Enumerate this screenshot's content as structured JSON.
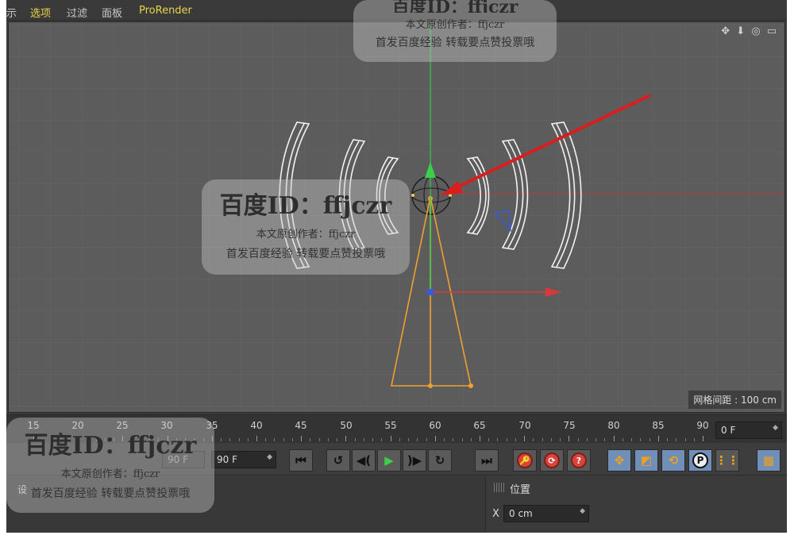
{
  "menu": {
    "items": [
      "示",
      "选项",
      "过滤",
      "面板",
      "ProRender"
    ],
    "active_color": "#e8d44a"
  },
  "viewport": {
    "grid_label": "网格间距 : 100 cm",
    "axis_colors": {
      "x": "#d83a3a",
      "y": "#3ad04a",
      "z": "#3a5ad8"
    },
    "object_color": "#f0a030",
    "wire_color": "#f2f2f2",
    "annotation_arrow_color": "#d81e1e",
    "nav_icons": "✥ ⬇ ◎ ▭"
  },
  "timeline": {
    "ticks": [
      "15",
      "20",
      "25",
      "30",
      "35",
      "40",
      "45",
      "50",
      "55",
      "60",
      "65",
      "70",
      "75",
      "80",
      "85",
      "90"
    ],
    "current_frame": "0 F"
  },
  "transport": {
    "start_field": "90 F",
    "end_field": "90 F",
    "buttons": {
      "goto_start": "⏮",
      "prev_key": "↺",
      "prev_frame": "◀(",
      "play": "▶",
      "next_frame": ")▶",
      "next_key": "↻",
      "goto_end": "⏭",
      "record_a": "🔑",
      "record_b": "⟳",
      "record_help": "?",
      "move": "✥",
      "scale": "◩",
      "rotate": "⟲",
      "param": "P",
      "dots": "⋮⋮",
      "film": "▦"
    }
  },
  "attributes": {
    "title": "位置",
    "x_label": "X",
    "x_value": "0 cm"
  },
  "bottom_left": {
    "label": "设"
  },
  "watermarks": [
    {
      "big": "百度ID：ffjczr",
      "line1": "本文原创作者：ffjczr",
      "line2": "首发百度经验  转载要点赞投票哦"
    },
    {
      "big": "百度ID：ffjczr",
      "line1": "本文原创作者：ffjczr",
      "line2": "首发百度经验  转载要点赞投票哦"
    },
    {
      "big": "百度ID：ffjczr",
      "line1": "本文原创作者：ffjczr",
      "line2": "首发百度经验  转载要点赞投票哦"
    }
  ]
}
